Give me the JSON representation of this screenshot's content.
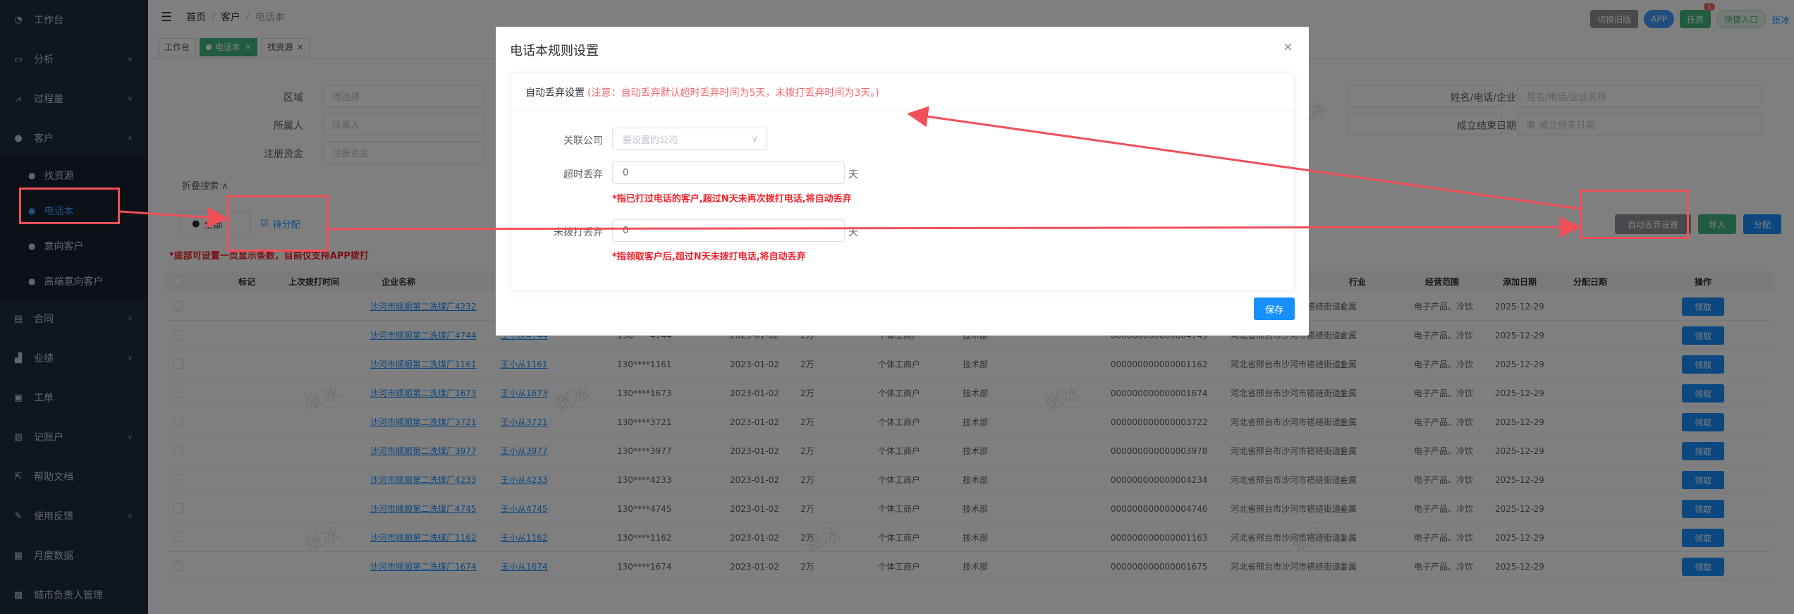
{
  "sidebar": {
    "items": [
      {
        "label": "工作台",
        "icon": "dashboard-icon"
      },
      {
        "label": "分析",
        "icon": "chart-icon"
      },
      {
        "label": "过程量",
        "icon": "process-icon"
      },
      {
        "label": "客户",
        "icon": "user-icon"
      },
      {
        "label": "合同",
        "icon": "contract-icon"
      },
      {
        "label": "业绩",
        "icon": "performance-icon"
      },
      {
        "label": "工单",
        "icon": "ticket-icon"
      },
      {
        "label": "记账户",
        "icon": "account-icon"
      },
      {
        "label": "帮助文档",
        "icon": "help-icon"
      },
      {
        "label": "使用反馈",
        "icon": "feedback-icon"
      },
      {
        "label": "月度数据",
        "icon": "monthly-icon"
      },
      {
        "label": "城市负责人管理",
        "icon": "city-icon"
      }
    ],
    "subitems": [
      {
        "label": "找资源"
      },
      {
        "label": "电话本"
      },
      {
        "label": "意向客户"
      },
      {
        "label": "高端意向客户"
      }
    ]
  },
  "navbar": {
    "breadcrumb": [
      "首页",
      "客户",
      "电话本"
    ],
    "user": "张冰",
    "buttons": [
      {
        "label": "切换旧版",
        "color": "#909399"
      },
      {
        "label": "APP",
        "color": "#409eff"
      },
      {
        "label": "任务",
        "color": "#42b983",
        "badge": "1"
      },
      {
        "label": "快捷入口",
        "color": "#e8f4ea"
      }
    ]
  },
  "tags": [
    {
      "label": "工作台"
    },
    {
      "label": "电话本"
    },
    {
      "label": "找资源"
    }
  ],
  "search": {
    "fields": [
      {
        "label": "区域",
        "placeholder": "请选择"
      },
      {
        "label": "所属人",
        "placeholder": "所属人"
      },
      {
        "label": "注册资金",
        "placeholder": "注册资金"
      },
      {
        "label": "姓名/电话/企业",
        "placeholder": "姓名/电话/企业名称"
      },
      {
        "label": "成立结束日期",
        "placeholder": "成立结束日期"
      }
    ],
    "collapse": "折叠搜索"
  },
  "tabs": {
    "all": "全部",
    "pending": "待分配"
  },
  "notice": "*底部可设置一页显示条数，目前仅支持APP拨打",
  "actions": {
    "auto_abandon": "自动丢弃设置",
    "import": "导入",
    "assign": "分配"
  },
  "table": {
    "headers": [
      "标记",
      "上次拨打时间",
      "企业名称",
      "行业",
      "经营范围",
      "添加日期",
      "分配日期",
      "操作"
    ],
    "rows": [
      {
        "company": "沙河市顺顺第二洗煤厂4232",
        "person": "",
        "phone": "",
        "date": "",
        "capital": "",
        "type": "",
        "dept": "",
        "code": "",
        "addr": "河北省邢台市沙河市褡裢街道4...",
        "industry": "金属",
        "scope": "电子产品、冷饮",
        "added": "2025-12-29",
        "btn": "领取"
      },
      {
        "company": "沙河市顺顺第二洗煤厂4744",
        "person": "王小从4744",
        "phone": "130****4744",
        "date": "2023-01-02",
        "capital": "2万",
        "type": "个体工商户",
        "dept": "技术部",
        "code": "000000000000004745",
        "addr": "河北省邢台市沙河市褡裢街道4...",
        "industry": "金属",
        "scope": "电子产品、冷饮",
        "added": "2025-12-29",
        "btn": "领取"
      },
      {
        "company": "沙河市顺顺第二洗煤厂1161",
        "person": "王小从1161",
        "phone": "130****1161",
        "date": "2023-01-02",
        "capital": "2万",
        "type": "个体工商户",
        "dept": "技术部",
        "code": "000000000000001162",
        "addr": "河北省邢台市沙河市褡裢街道1...",
        "industry": "金属",
        "scope": "电子产品、冷饮",
        "added": "2025-12-29",
        "btn": "领取"
      },
      {
        "company": "沙河市顺顺第二洗煤厂1673",
        "person": "王小从1673",
        "phone": "130****1673",
        "date": "2023-01-02",
        "capital": "2万",
        "type": "个体工商户",
        "dept": "技术部",
        "code": "000000000000001674",
        "addr": "河北省邢台市沙河市褡裢街道1...",
        "industry": "金属",
        "scope": "电子产品、冷饮",
        "added": "2025-12-29",
        "btn": "领取"
      },
      {
        "company": "沙河市顺顺第二洗煤厂3721",
        "person": "王小从3721",
        "phone": "130****3721",
        "date": "2023-01-02",
        "capital": "2万",
        "type": "个体工商户",
        "dept": "技术部",
        "code": "000000000000003722",
        "addr": "河北省邢台市沙河市褡裢街道3...",
        "industry": "金属",
        "scope": "电子产品、冷饮",
        "added": "2025-12-29",
        "btn": "领取"
      },
      {
        "company": "沙河市顺顺第二洗煤厂3977",
        "person": "王小从3977",
        "phone": "130****3977",
        "date": "2023-01-02",
        "capital": "2万",
        "type": "个体工商户",
        "dept": "技术部",
        "code": "000000000000003978",
        "addr": "河北省邢台市沙河市褡裢街道3...",
        "industry": "金属",
        "scope": "电子产品、冷饮",
        "added": "2025-12-29",
        "btn": "领取"
      },
      {
        "company": "沙河市顺顺第二洗煤厂4233",
        "person": "王小从4233",
        "phone": "130****4233",
        "date": "2023-01-02",
        "capital": "2万",
        "type": "个体工商户",
        "dept": "技术部",
        "code": "000000000000004234",
        "addr": "河北省邢台市沙河市褡裢街道4...",
        "industry": "金属",
        "scope": "电子产品、冷饮",
        "added": "2025-12-29",
        "btn": "领取"
      },
      {
        "company": "沙河市顺顺第二洗煤厂4745",
        "person": "王小从4745",
        "phone": "130****4745",
        "date": "2023-01-02",
        "capital": "2万",
        "type": "个体工商户",
        "dept": "技术部",
        "code": "000000000000004746",
        "addr": "河北省邢台市沙河市褡裢街道4...",
        "industry": "金属",
        "scope": "电子产品、冷饮",
        "added": "2025-12-29",
        "btn": "领取"
      },
      {
        "company": "沙河市顺顺第二洗煤厂1162",
        "person": "王小从1162",
        "phone": "130****1162",
        "date": "2023-01-02",
        "capital": "2万",
        "type": "个体工商户",
        "dept": "技术部",
        "code": "000000000000001163",
        "addr": "河北省邢台市沙河市褡裢街道1...",
        "industry": "金属",
        "scope": "电子产品、冷饮",
        "added": "2025-12-29",
        "btn": "领取"
      },
      {
        "company": "沙河市顺顺第二洗煤厂1674",
        "person": "王小从1674",
        "phone": "130****1674",
        "date": "2023-01-02",
        "capital": "2万",
        "type": "个体工商户",
        "dept": "技术部",
        "code": "000000000000001675",
        "addr": "河北省邢台市沙河市褡裢街道1...",
        "industry": "金属",
        "scope": "电子产品、冷饮",
        "added": "2025-12-29",
        "btn": "领取"
      }
    ]
  },
  "modal": {
    "title": "电话本规则设置",
    "section_title": "自动丢弃设置",
    "section_note": "(注意：自动丢弃默认超时丢弃时间为5天，未拨打丢弃时间为3天。)",
    "company_label": "关联公司",
    "company_placeholder": "要设置的公司",
    "timeout_label": "超时丢弃",
    "timeout_value": "0",
    "timeout_unit": "天",
    "timeout_hint": "*指已打过电话的客户,超过N天未再次拨打电话,将自动丢弃",
    "nocall_label": "未拨打丢弃",
    "nocall_value": "0",
    "nocall_unit": "天",
    "nocall_hint": "*指领取客户后,超过N天未拨打电话,将自动丢弃",
    "save": "保存"
  },
  "watermark": "张冰",
  "colors": {
    "sidebar": "#1f2d3d",
    "primary": "#1890ff",
    "annotation": "#f0505a",
    "hint": "#f5222d"
  }
}
